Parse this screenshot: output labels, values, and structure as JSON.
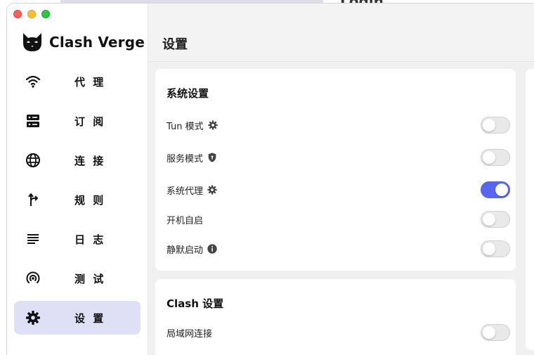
{
  "app": {
    "name": "Clash Verge"
  },
  "background": {
    "title_fragment": "Login"
  },
  "sidebar": {
    "items": [
      {
        "label": "代 理",
        "icon": "wifi-icon",
        "active": false
      },
      {
        "label": "订 阅",
        "icon": "server-icon",
        "active": false
      },
      {
        "label": "连 接",
        "icon": "globe-icon",
        "active": false
      },
      {
        "label": "规 则",
        "icon": "fork-arrow-icon",
        "active": false
      },
      {
        "label": "日 志",
        "icon": "list-lines-icon",
        "active": false
      },
      {
        "label": "测 试",
        "icon": "radar-icon",
        "active": false
      },
      {
        "label": "设 置",
        "icon": "gear-icon",
        "active": true
      }
    ]
  },
  "header": {
    "title": "设置"
  },
  "system_settings": {
    "title": "系统设置",
    "rows": [
      {
        "label": "Tun 模式",
        "icon": "gear-icon",
        "enabled": false
      },
      {
        "label": "服务模式",
        "icon": "shield-icon",
        "enabled": false
      },
      {
        "label": "系统代理",
        "icon": "gear-icon",
        "enabled": true
      },
      {
        "label": "开机自启",
        "icon": "",
        "enabled": false
      },
      {
        "label": "静默启动",
        "icon": "info-icon",
        "enabled": false
      }
    ]
  },
  "clash_settings": {
    "title": "Clash 设置",
    "rows": [
      {
        "label": "局域网连接",
        "enabled": false
      }
    ]
  },
  "colors": {
    "accent": "#5866ee",
    "active_nav": "#dfe0f5"
  }
}
